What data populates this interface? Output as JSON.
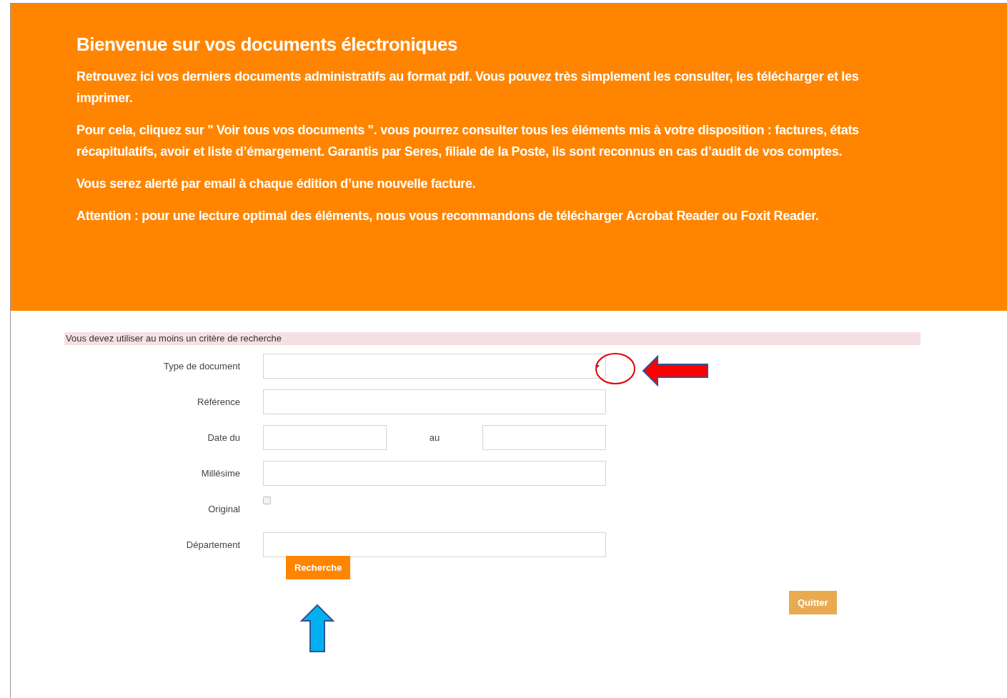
{
  "banner": {
    "title": "Bienvenue sur vos documents électroniques",
    "paragraphs": [
      "Retrouvez ici vos derniers documents administratifs au format pdf. Vous pouvez très simplement les consulter, les télécharger et les imprimer.",
      "Pour cela, cliquez sur \" Voir tous vos documents \". vous pourrez consulter tous les éléments mis à votre disposition : factures, états récapitulatifs, avoir et liste d’émargement. Garantis par Seres, filiale de la Poste, ils sont reconnus en cas d’audit de vos comptes.",
      "Vous serez alerté par email à chaque édition d’une nouvelle facture.",
      "Attention : pour une lecture optimal des éléments, nous vous recommandons de télécharger Acrobat Reader ou Foxit Reader."
    ]
  },
  "form": {
    "notice": "Vous devez utiliser au moins un critère de recherche",
    "fields": [
      {
        "kind": "select",
        "label": "Type de document"
      },
      {
        "kind": "text",
        "label": "Référence"
      },
      {
        "kind": "daterange",
        "label": "Date du",
        "separator": "au"
      },
      {
        "kind": "text",
        "label": "Millésime"
      },
      {
        "kind": "checkbox",
        "label": "Original",
        "checked": false
      },
      {
        "kind": "text",
        "label": "Département"
      }
    ],
    "search_button": "Recherche",
    "quit_button": "Quitter"
  }
}
